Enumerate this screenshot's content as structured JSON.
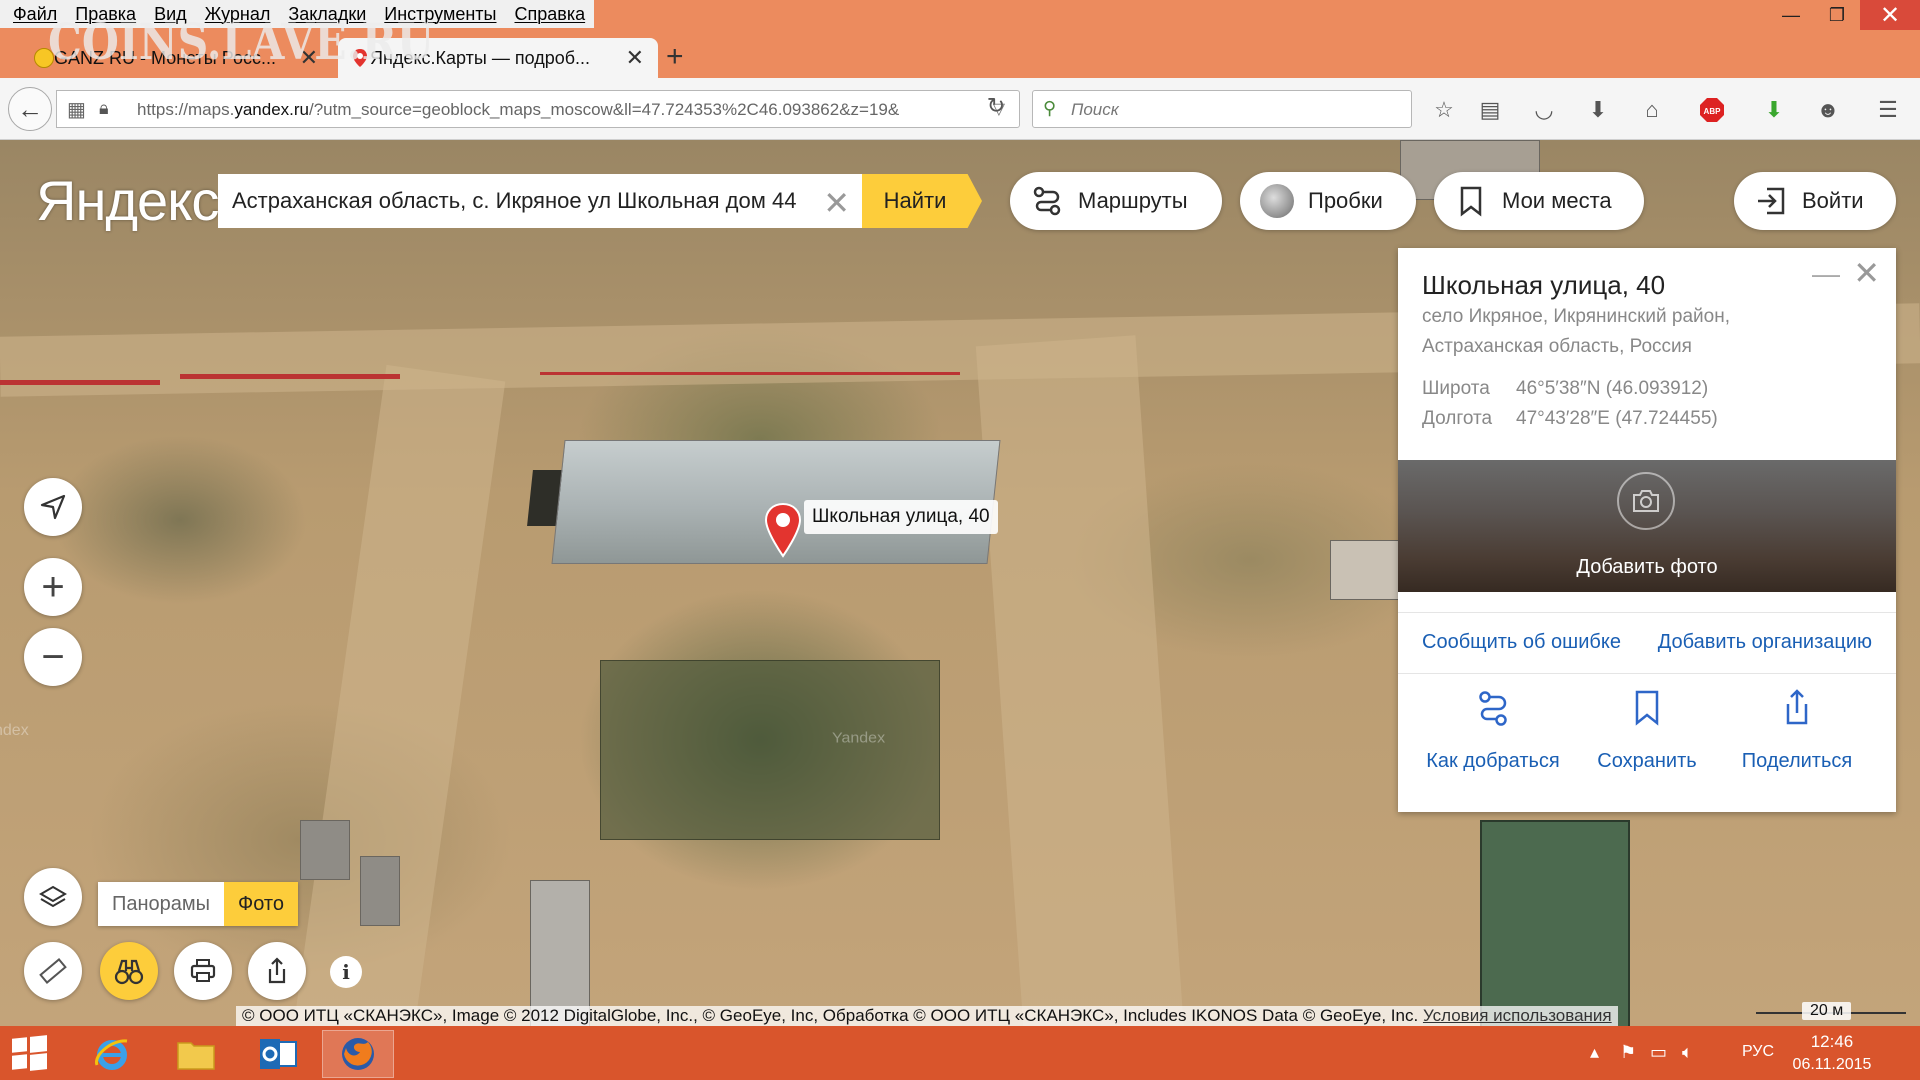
{
  "browser": {
    "watermark": "COINS.LAVE.RU",
    "menu": [
      "Файл",
      "Правка",
      "Вид",
      "Журнал",
      "Закладки",
      "Инструменты",
      "Справка"
    ],
    "tabs": [
      {
        "title": "GANZ RU - Монеты Росс..."
      },
      {
        "title": "Яндекс.Карты — подроб..."
      }
    ],
    "new_tab": "+",
    "url_prefix": "https://maps.",
    "url_domain": "yandex.ru",
    "url_rest": "/?utm_source=geoblock_maps_moscow&ll=47.724353%2C46.093862&z=19&",
    "search_placeholder": "Поиск",
    "window_controls": {
      "minimize": "—",
      "maximize": "❐",
      "close": "✕"
    }
  },
  "map": {
    "logo": "Яндекс",
    "search_value": "Астраханская область, с. Икряное ул Школьная дом 44",
    "find_label": "Найти",
    "buttons": {
      "routes": "Маршруты",
      "traffic": "Пробки",
      "places": "Мои места",
      "login": "Войти"
    },
    "layer_modes": {
      "panoramas": "Панорамы",
      "photo": "Фото"
    },
    "marker_label": "Школьная улица, 40",
    "ghost_watermark": "Yandex",
    "ghost_watermark2": "ndex",
    "copyright_text": "© ООО ИТЦ «СКАНЭКС», Image © 2012 DigitalGlobe, Inc., © GeoEye, Inc, Обработка © ООО ИТЦ «СКАНЭКС», Includes IKONOS Data © GeoEye, Inc.",
    "terms_link": "Условия использования",
    "scale_label": "20 м"
  },
  "card": {
    "title": "Школьная улица, 40",
    "address_line1": "село Икряное, Икрянинский район,",
    "address_line2": "Астраханская область, Россия",
    "lat_label": "Широта",
    "lat_value": "46°5′38″N (46.093912)",
    "lon_label": "Долгота",
    "lon_value": "47°43′28″E (47.724455)",
    "add_photo": "Добавить фото",
    "report_error": "Сообщить об ошибке",
    "add_org": "Добавить организацию",
    "actions": {
      "directions": "Как добраться",
      "save": "Сохранить",
      "share": "Поделиться"
    }
  },
  "taskbar": {
    "language": "РУС",
    "time": "12:46",
    "date": "06.11.2015"
  }
}
